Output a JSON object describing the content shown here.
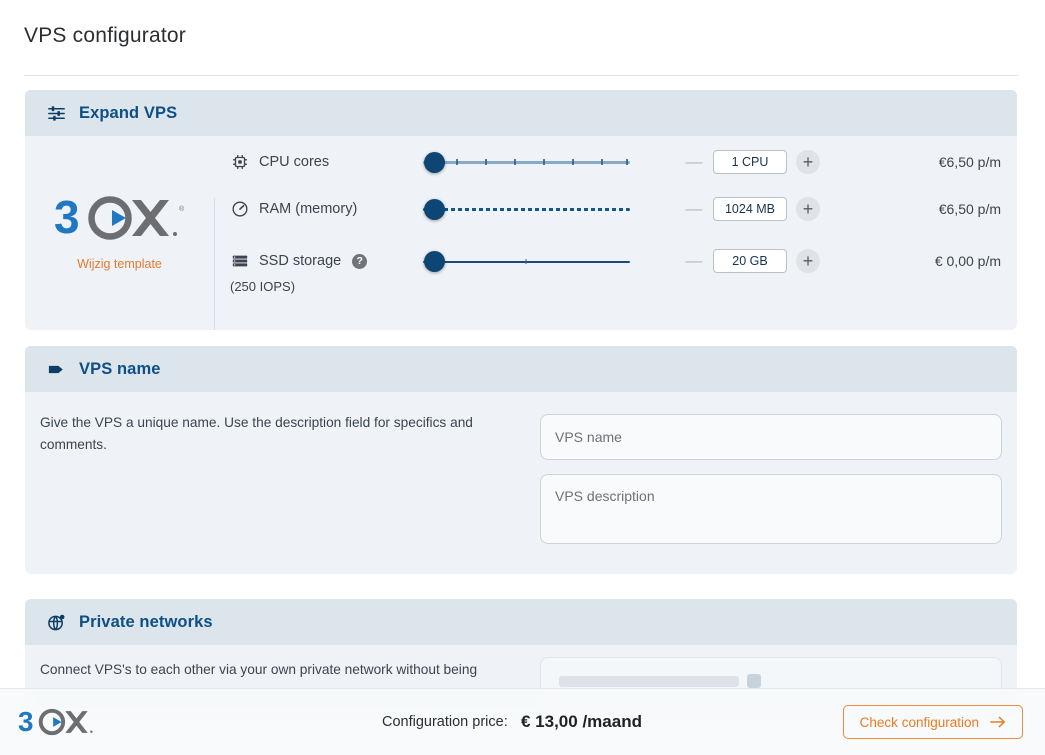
{
  "page": {
    "title": "VPS configurator"
  },
  "expand_card": {
    "title": "Expand VPS",
    "icon": "sliders-icon",
    "template": {
      "logo_alt": "3CX",
      "change_link": "Wijzig template"
    },
    "rows": [
      {
        "icon": "cpu-chip-icon",
        "label": "CPU cores",
        "value": "1 CPU",
        "price": "€6,50 p/m",
        "minus_label": "—",
        "plus_label": "+",
        "slider": {
          "type": "ticked",
          "ticks": 7,
          "position_pct": 0
        }
      },
      {
        "icon": "gauge-icon",
        "label": "RAM (memory)",
        "value": "1024 MB",
        "price": "€6,50 p/m",
        "minus_label": "—",
        "plus_label": "+",
        "slider": {
          "type": "dotted",
          "position_pct": 0
        }
      },
      {
        "icon": "storage-icon",
        "label": "SSD storage",
        "help_badge": "?",
        "sublabel": "(250 IOPS)",
        "value": "20 GB",
        "price": "€ 0,00 p/m",
        "minus_label": "—",
        "plus_label": "+",
        "slider": {
          "type": "solid",
          "position_pct": 0
        }
      }
    ]
  },
  "name_card": {
    "title": "VPS name",
    "icon": "tag-icon",
    "help_text": "Give the VPS a unique name. Use the description field for specifics and comments.",
    "name_placeholder": "VPS name",
    "description_placeholder": "VPS description"
  },
  "private_card": {
    "title": "Private networks",
    "icon": "globe-network-icon",
    "text": "Connect VPS's to each other via your own private network without being"
  },
  "bottom_bar": {
    "logo_alt": "3CX",
    "price_label": "Configuration price:",
    "price_value": "€ 13,00 /maand",
    "cta_label": "Check configuration",
    "cta_icon": "arrow-right-icon"
  },
  "colors": {
    "heading_blue": "#0e4f85",
    "card_body": "#eff3f7",
    "card_header": "#dce4ec",
    "accent_orange": "#ea7b23",
    "slider_navy": "#0d4575",
    "logo_blue": "#1f78c1",
    "logo_gray": "#6d6e71"
  }
}
